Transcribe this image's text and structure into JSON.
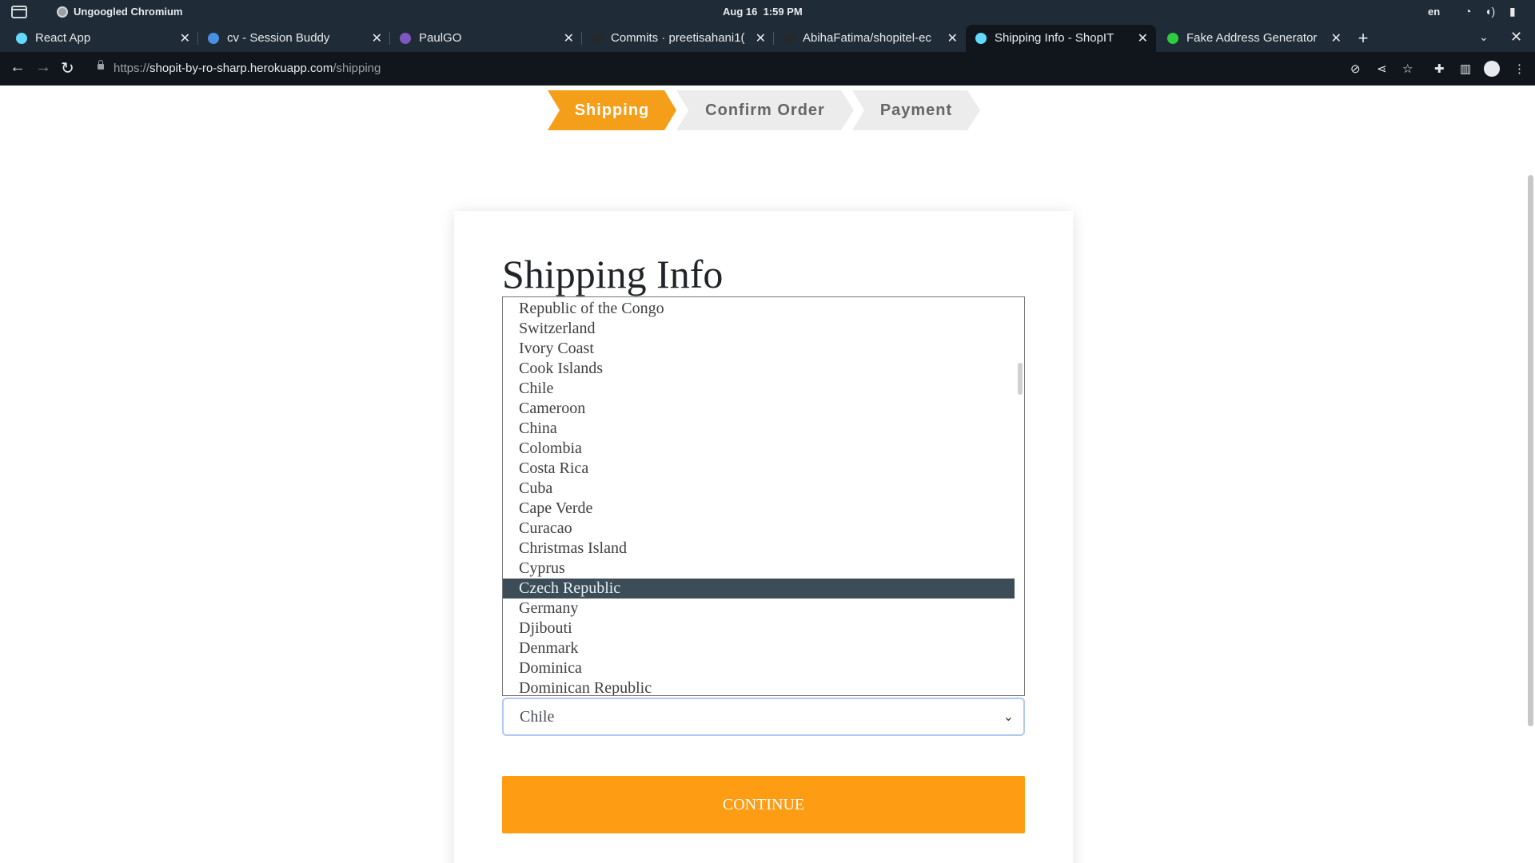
{
  "os": {
    "app_name": "Ungoogled Chromium",
    "date": "Aug 16",
    "time": "1:59 PM",
    "lang": "en"
  },
  "tabs": [
    {
      "title": "React App",
      "favicon_color": "#61dafb",
      "active": false
    },
    {
      "title": "cv - Session Buddy",
      "favicon_color": "#4a90e2",
      "active": false
    },
    {
      "title": "PaulGO",
      "favicon_color": "#7e57c2",
      "active": false
    },
    {
      "title": "Commits · preetisahani1(",
      "favicon_color": "#24292e",
      "active": false
    },
    {
      "title": "AbihaFatima/shopitel-ec",
      "favicon_color": "#24292e",
      "active": false
    },
    {
      "title": "Shipping Info - ShopIT",
      "favicon_color": "#61dafb",
      "active": true
    },
    {
      "title": "Fake Address Generator",
      "favicon_color": "#2ecc40",
      "active": false
    }
  ],
  "toolbar": {
    "url_scheme": "https://",
    "url_host": "shopit-by-ro-sharp.herokuapp.com",
    "url_path": "/shipping"
  },
  "steps": [
    {
      "label": "Shipping",
      "active": true
    },
    {
      "label": "Confirm Order",
      "active": false
    },
    {
      "label": "Payment",
      "active": false
    }
  ],
  "form": {
    "title": "Shipping Info",
    "country_options": [
      "Republic of the Congo",
      "Switzerland",
      "Ivory Coast",
      "Cook Islands",
      "Chile",
      "Cameroon",
      "China",
      "Colombia",
      "Costa Rica",
      "Cuba",
      "Cape Verde",
      "Curacao",
      "Christmas Island",
      "Cyprus",
      "Czech Republic",
      "Germany",
      "Djibouti",
      "Denmark",
      "Dominica",
      "Dominican Republic"
    ],
    "highlighted_option": "Czech Republic",
    "selected_country": "Chile",
    "continue_label": "CONTINUE"
  },
  "colors": {
    "accent": "#fe9c13",
    "step_active": "#f59e1a",
    "highlight": "#3c4d57"
  }
}
